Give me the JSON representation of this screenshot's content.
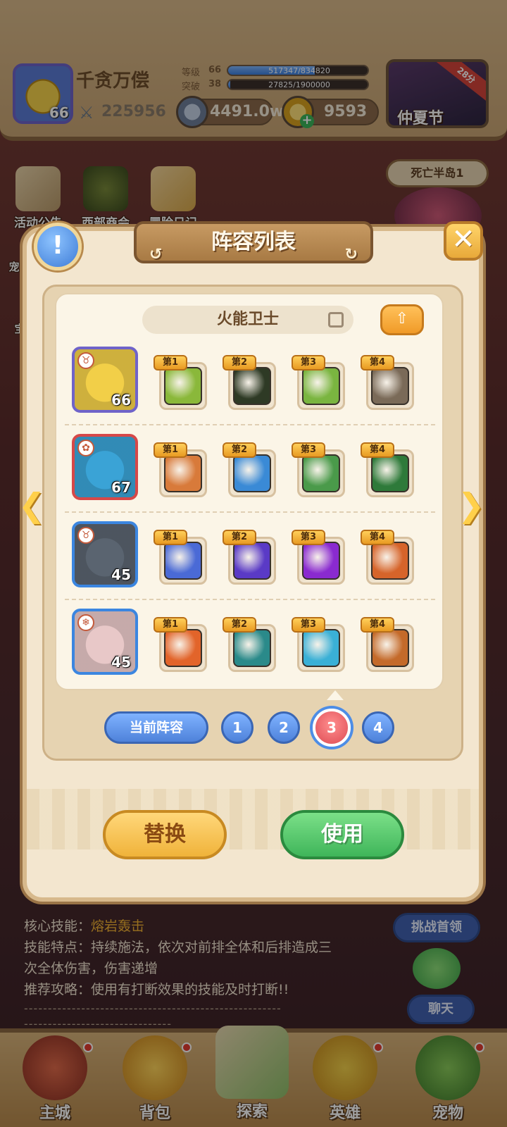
{
  "header": {
    "player_name": "千贪万偿",
    "player_level": "66",
    "power": "225956",
    "level_label": "等级",
    "level_value": "66",
    "level_exp": "517347/834820",
    "level_fill": 0.62,
    "break_label": "突破",
    "break_value": "38",
    "break_exp": "27825/1900000",
    "break_fill": 0.015,
    "currency_1": "4491.0w",
    "currency_2": "9593",
    "event_name": "仲夏节",
    "event_badge": "28分"
  },
  "background_buttons": [
    {
      "label": "活动公告"
    },
    {
      "label": "西部商会"
    },
    {
      "label": "冒险日记"
    }
  ],
  "region_tab": "死亡半岛1",
  "side_left_labels": [
    "宠",
    "宝"
  ],
  "dialog": {
    "title": "阵容列表",
    "lineup_name": "火能卫士",
    "heroes": [
      {
        "level": "66",
        "portrait_color": "#f2cf48",
        "border": "#6f63c9",
        "class_icon": "horns-icon",
        "skills": [
          {
            "tag": "第1",
            "color": "#8ab83a",
            "icon": "spiked-arrow-icon"
          },
          {
            "tag": "第2",
            "color": "#2e3a25",
            "icon": "shadow-beast-icon"
          },
          {
            "tag": "第3",
            "color": "#7ab540",
            "icon": "star-shield-icon"
          },
          {
            "tag": "第4",
            "color": "#7a6a58",
            "icon": "fist-hammer-icon"
          }
        ]
      },
      {
        "level": "67",
        "portrait_color": "#3aa3d6",
        "border": "#d64848",
        "class_icon": "leaf-icon",
        "skills": [
          {
            "tag": "第1",
            "color": "#d87a3a",
            "icon": "lion-icon"
          },
          {
            "tag": "第2",
            "color": "#3a8ad6",
            "icon": "spear-icon"
          },
          {
            "tag": "第3",
            "color": "#4a9a4a",
            "icon": "target-icon"
          },
          {
            "tag": "第4",
            "color": "#2e7a3a",
            "icon": "green-blade-icon"
          }
        ]
      },
      {
        "level": "45",
        "portrait_color": "#5a6470",
        "border": "#3b86e0",
        "class_icon": "horns-icon",
        "skills": [
          {
            "tag": "第1",
            "color": "#4a6ad6",
            "icon": "blue-claw-icon"
          },
          {
            "tag": "第2",
            "color": "#5a3ac6",
            "icon": "purple-rain-icon"
          },
          {
            "tag": "第3",
            "color": "#8a2ad0",
            "icon": "purple-burst-icon"
          },
          {
            "tag": "第4",
            "color": "#d6642a",
            "icon": "paw-icon"
          }
        ]
      },
      {
        "level": "45",
        "portrait_color": "#e8c8c8",
        "border": "#3b86e0",
        "class_icon": "snowflake-icon",
        "skills": [
          {
            "tag": "第1",
            "color": "#e2642a",
            "icon": "fist-icon"
          },
          {
            "tag": "第2",
            "color": "#2a8a8a",
            "icon": "red-mask-icon"
          },
          {
            "tag": "第3",
            "color": "#3ab0d6",
            "icon": "ice-staff-icon"
          },
          {
            "tag": "第4",
            "color": "#c46a2a",
            "icon": "fire-hammer-icon"
          }
        ]
      }
    ],
    "current_label": "当前阵容",
    "slots": [
      "1",
      "2",
      "3",
      "4"
    ],
    "active_slot": "3",
    "replace_label": "替换",
    "use_label": "使用",
    "info_symbol": "!",
    "close_symbol": "✕",
    "share_symbol": "⇧",
    "prev_symbol": "❮",
    "next_symbol": "❯"
  },
  "description": {
    "core_label": "核心技能：",
    "core_value": "熔岩轰击",
    "feature_line_1": "技能特点：持续施法，依次对前排全体和后排造成三",
    "feature_line_2": "次全体伤害，伤害递增",
    "tip": "推荐攻略：使用有打断效果的技能及时打断!!",
    "dashes_1": "------------------------------------------------------",
    "dashes_2": "-------------------------------"
  },
  "side_buttons": {
    "challenge": "挑战首领",
    "chat": "聊天"
  },
  "nav": [
    {
      "label": "主城"
    },
    {
      "label": "背包"
    },
    {
      "label": "探索"
    },
    {
      "label": "英雄"
    },
    {
      "label": "宠物"
    }
  ]
}
